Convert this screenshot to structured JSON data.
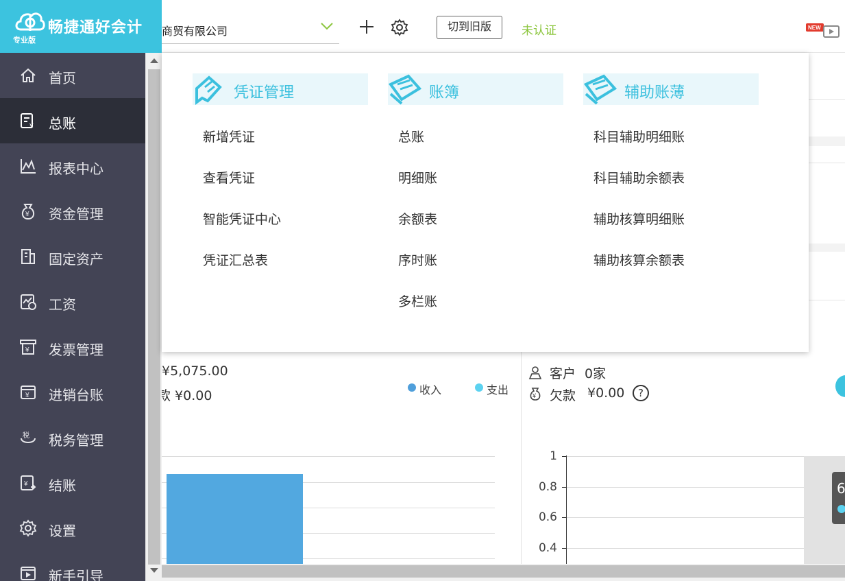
{
  "brand": {
    "name": "畅捷通好会计",
    "edition": "专业版"
  },
  "header": {
    "company": "商贸有限公司",
    "old_version_label": "切到旧版",
    "cert_status": "未认证"
  },
  "sidebar": {
    "items": [
      {
        "label": "首页",
        "icon": "home-icon"
      },
      {
        "label": "总账",
        "icon": "ledger-icon",
        "active": true
      },
      {
        "label": "报表中心",
        "icon": "chart-icon"
      },
      {
        "label": "资金管理",
        "icon": "money-bag-icon"
      },
      {
        "label": "固定资产",
        "icon": "building-icon"
      },
      {
        "label": "工资",
        "icon": "salary-icon"
      },
      {
        "label": "发票管理",
        "icon": "invoice-icon"
      },
      {
        "label": "进销台账",
        "icon": "inventory-icon"
      },
      {
        "label": "税务管理",
        "icon": "tax-icon"
      },
      {
        "label": "结账",
        "icon": "close-account-icon"
      },
      {
        "label": "设置",
        "icon": "gear-icon"
      },
      {
        "label": "新手引导",
        "icon": "video-icon"
      }
    ]
  },
  "menu": {
    "columns": [
      {
        "title": "凭证管理",
        "items": [
          "新增凭证",
          "查看凭证",
          "智能凭证中心",
          "凭证汇总表"
        ]
      },
      {
        "title": "账簿",
        "items": [
          "总账",
          "明细账",
          "余额表",
          "序时账",
          "多栏账"
        ]
      },
      {
        "title": "辅助账薄",
        "items": [
          "科目辅助明细账",
          "科目辅助余额表",
          "辅助核算明细账",
          "辅助核算余额表"
        ]
      }
    ]
  },
  "dashboard": {
    "left": {
      "amount_line": "¥5,075.00",
      "debt_line": "款 ¥0.00",
      "legend": [
        {
          "name": "收入",
          "color": "#4f9fdb"
        },
        {
          "name": "支出",
          "color": "#5cd2f0"
        }
      ]
    },
    "right": {
      "customer_label": "客户",
      "customer_value": "0家",
      "debt_label": "欠款",
      "debt_value": "¥0.00",
      "help_symbol": "?",
      "tooltip_text": "6"
    }
  },
  "chart_data": [
    {
      "type": "bar",
      "categories": [
        ""
      ],
      "series": [
        {
          "values": [
            0.8
          ]
        }
      ],
      "ylim": [
        0,
        1
      ],
      "grid": true
    },
    {
      "type": "bar",
      "y_ticks": [
        "1",
        "0.8",
        "0.6",
        "0.4"
      ],
      "ylim": [
        0,
        1
      ],
      "grid": true
    }
  ],
  "colors": {
    "brand": "#3cc3df",
    "sidebar": "#434455",
    "sidebar_active": "#2c2e38",
    "cert": "#8cc63e",
    "bar": "#52a8e0"
  }
}
